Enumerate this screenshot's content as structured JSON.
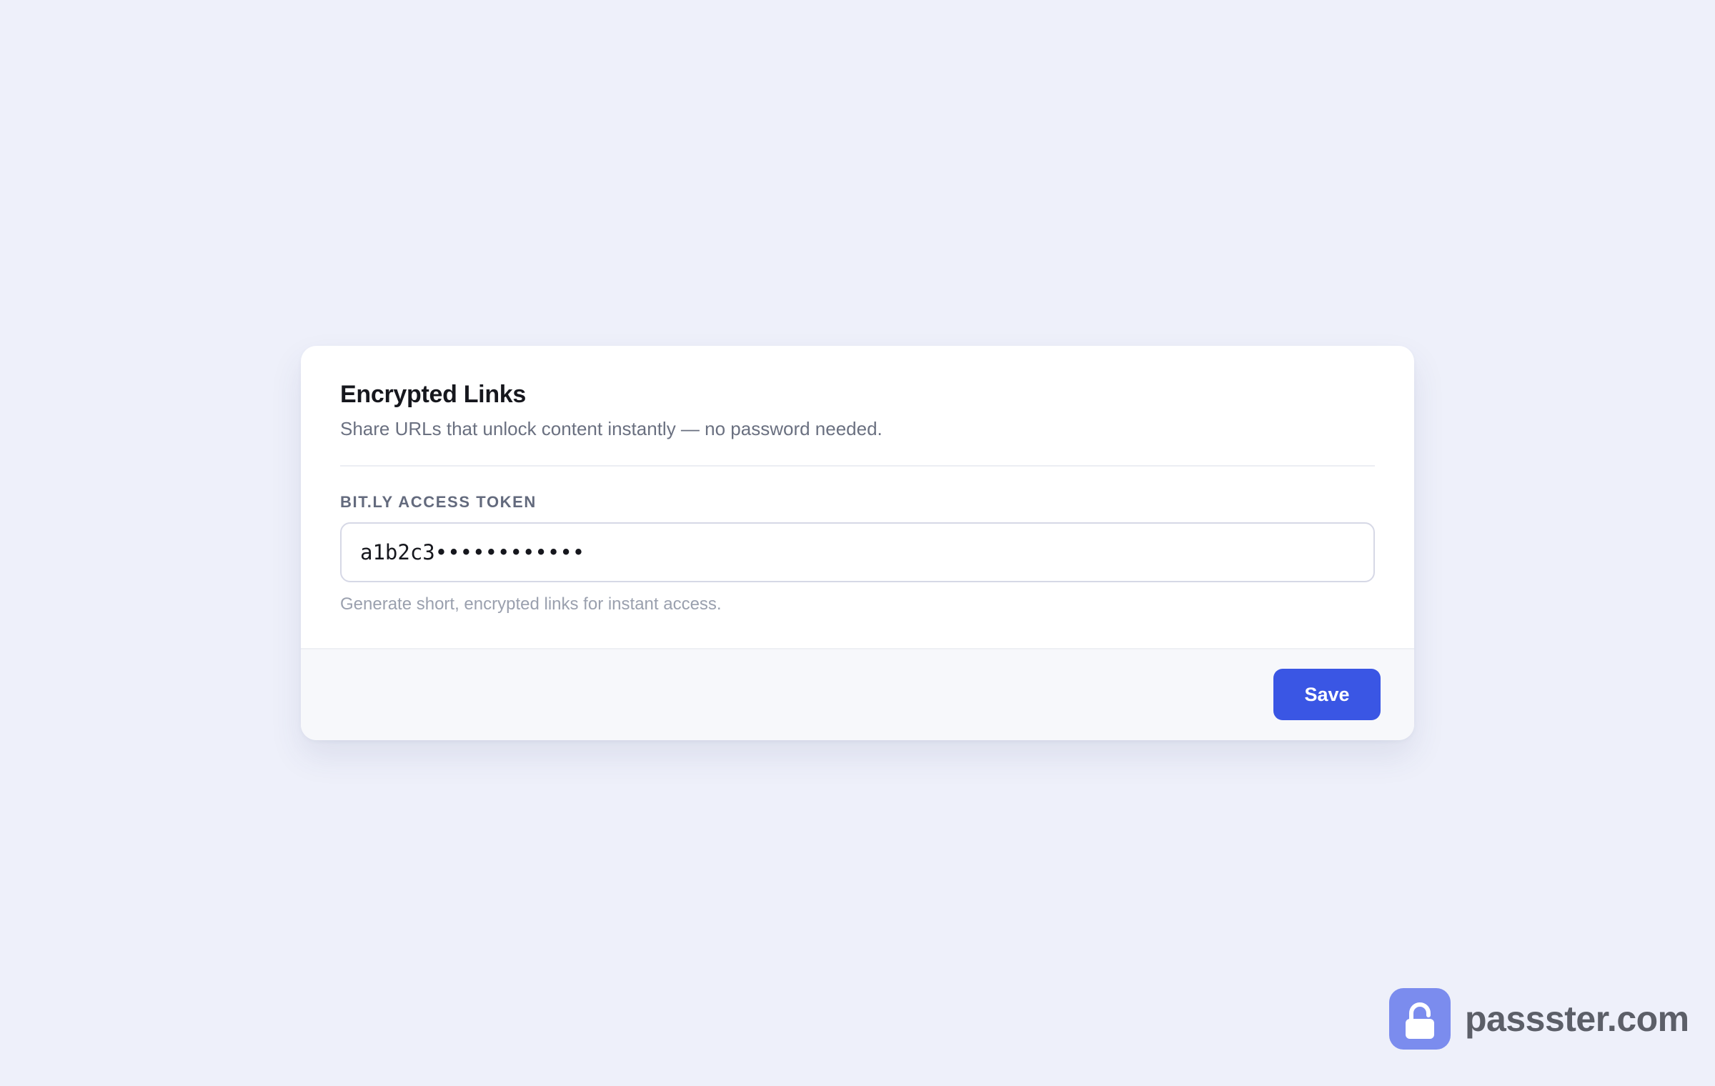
{
  "card": {
    "title": "Encrypted Links",
    "subtitle": "Share URLs that unlock content instantly — no password needed.",
    "field_label": "BIT.LY ACCESS TOKEN",
    "token_value": "a1b2c3••••••••••••",
    "hint": "Generate short, encrypted links for instant access.",
    "save_label": "Save"
  },
  "brand": {
    "name": "passster.com",
    "logo_icon": "lock-icon"
  },
  "colors": {
    "background": "#eef0fa",
    "accent": "#3a56e4",
    "logo": "#7b8cee"
  }
}
